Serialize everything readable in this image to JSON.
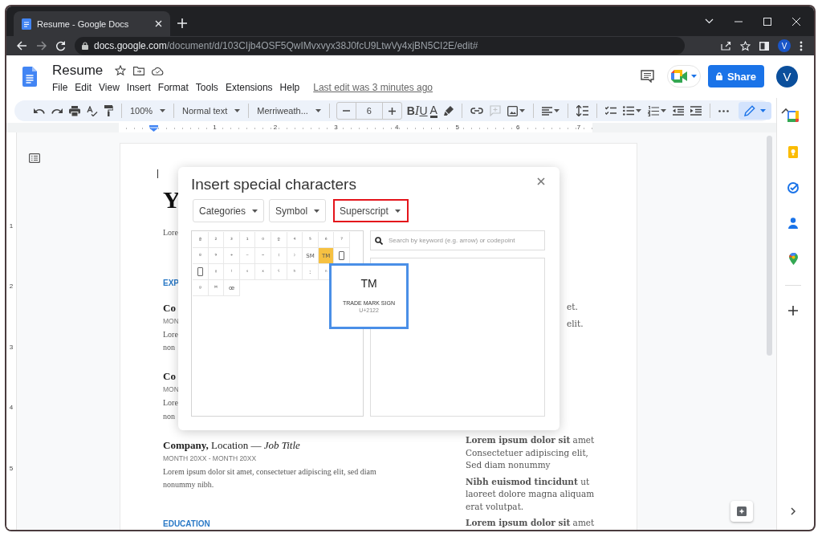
{
  "browser": {
    "tab": {
      "title": "Resume - Google Docs",
      "selected": true
    },
    "url_host": "docs.google.com",
    "url_path": "/document/d/103CIjb4OSF5QwIMvxvyx38J0fcU9LtwVy4xjBN5CI2E/edit#",
    "profile": "V"
  },
  "docs": {
    "title": "Resume",
    "menu": [
      "File",
      "Edit",
      "View",
      "Insert",
      "Format",
      "Tools",
      "Extensions",
      "Help"
    ],
    "last_edit": "Last edit was 3 minutes ago",
    "share": "Share",
    "avatar": "V"
  },
  "toolbar": {
    "zoom": "100%",
    "style": "Normal text",
    "font": "Merriweath...",
    "font_size": "6",
    "format_buttons": [
      "B",
      "I",
      "U",
      "A"
    ],
    "insert_comment": {
      "disabled": true
    },
    "editing_mode": {
      "selected": true
    }
  },
  "ruler": [
    "1",
    "2",
    "3",
    "4",
    "5",
    "6",
    "7"
  ],
  "vertical_ruler": [
    "1",
    "2",
    "3",
    "4",
    "5"
  ],
  "document": {
    "left": [
      {
        "kind": "title",
        "text": "Y"
      },
      {
        "kind": "body",
        "text": "Lore"
      },
      {
        "kind": "section",
        "text": "EXP"
      },
      {
        "kind": "role",
        "text": "**Co**"
      },
      {
        "kind": "date",
        "text": "MON"
      },
      {
        "kind": "body",
        "text": "Lore"
      },
      {
        "kind": "body",
        "text": "non"
      },
      {
        "kind": "role",
        "text": "**Co**"
      },
      {
        "kind": "date",
        "text": "MON"
      },
      {
        "kind": "body",
        "text": "Lore"
      },
      {
        "kind": "body",
        "text": "non"
      },
      {
        "kind": "role",
        "text": "**Company,** Location — *Job Title*"
      },
      {
        "kind": "date",
        "text": "MONTH 20XX - MONTH 20XX"
      },
      {
        "kind": "body",
        "text": "Lorem ipsum dolor sit amet, consectetuer adipiscing elit, sed diam"
      },
      {
        "kind": "body",
        "text": "nonummy nibh."
      },
      {
        "kind": "section",
        "text": "EDUCATION"
      }
    ],
    "right_fragments": [
      "et.",
      "elit."
    ],
    "right_paragraphs": [
      {
        "lines": [
          "**Lorem ipsum dolor sit** amet",
          "Consectetuer adipiscing elit,",
          "Sed diam nonummy"
        ]
      },
      {
        "lines": [
          "**Nibh euismod tincidunt** ut",
          "laoreet dolore magna aliquam",
          "erat volutpat."
        ]
      },
      {
        "lines": [
          "**Lorem ipsum dolor sit** amet"
        ]
      }
    ]
  },
  "dialog": {
    "title": "Insert special characters",
    "dropdowns": [
      {
        "label": "Categories",
        "annotated": false
      },
      {
        "label": "Symbol",
        "annotated": false
      },
      {
        "label": "Superscript",
        "annotated": true
      }
    ],
    "grid_rows": [
      [
        {
          "kind": "char",
          "char": "ª",
          "selected": false
        },
        {
          "kind": "char",
          "char": "²",
          "selected": false
        },
        {
          "kind": "char",
          "char": "³",
          "selected": false
        },
        {
          "kind": "char",
          "char": "¹",
          "selected": false
        },
        {
          "kind": "char",
          "char": "⁰",
          "selected": false
        },
        {
          "kind": "char",
          "char": "º",
          "selected": false
        },
        {
          "kind": "char",
          "char": "⁴",
          "selected": false
        },
        {
          "kind": "char",
          "char": "⁵",
          "selected": false
        },
        {
          "kind": "char",
          "char": "⁶",
          "selected": false
        },
        {
          "kind": "char",
          "char": "⁷",
          "selected": false
        }
      ],
      [
        {
          "kind": "char",
          "char": "⁸",
          "selected": false
        },
        {
          "kind": "char",
          "char": "⁹",
          "selected": false
        },
        {
          "kind": "char",
          "char": "⁺",
          "selected": false
        },
        {
          "kind": "char",
          "char": "⁻",
          "selected": false
        },
        {
          "kind": "char",
          "char": "⁼",
          "selected": false
        },
        {
          "kind": "char",
          "char": "⁽",
          "selected": false
        },
        {
          "kind": "char",
          "char": "⁾",
          "selected": false
        },
        {
          "kind": "char",
          "char": "SM",
          "selected": false
        },
        {
          "kind": "char",
          "char": "TM",
          "selected": true
        },
        {
          "kind": "missing",
          "selected": false
        }
      ],
      [
        {
          "kind": "missing",
          "selected": false
        },
        {
          "kind": "char",
          "char": "ˠ",
          "selected": false
        },
        {
          "kind": "char",
          "char": "ˡ",
          "selected": false
        },
        {
          "kind": "char",
          "char": "ˢ",
          "selected": false
        },
        {
          "kind": "char",
          "char": "ˣ",
          "selected": false
        },
        {
          "kind": "char",
          "char": "ˤ",
          "selected": false
        },
        {
          "kind": "char",
          "char": "ʰ",
          "selected": false
        },
        {
          "kind": "char",
          "char": "ː",
          "selected": false
        },
        {
          "kind": "char",
          "char": "ⁿ",
          "selected": false
        }
      ],
      [
        {
          "kind": "char",
          "char": "ᵍ",
          "selected": false
        },
        {
          "kind": "char",
          "char": "ᴹ",
          "selected": false
        },
        {
          "kind": "char",
          "char": "œ",
          "selected": false
        }
      ]
    ],
    "search": {
      "placeholder": "Search by keyword (e.g. arrow) or codepoint"
    },
    "tooltip": {
      "glyph": "TM",
      "name": "TRADE MARK SIGN",
      "code": "U+2122"
    }
  }
}
